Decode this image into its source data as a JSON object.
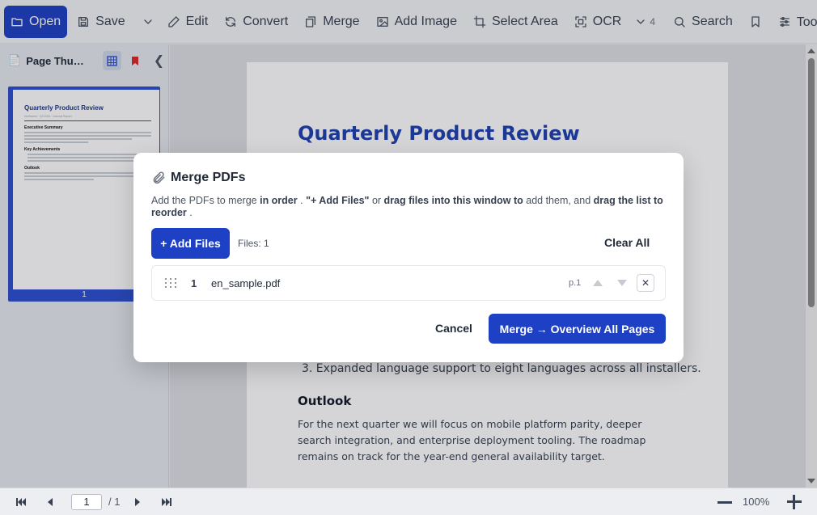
{
  "toolbar": {
    "open": "Open",
    "save": "Save",
    "edit": "Edit",
    "convert": "Convert",
    "merge": "Merge",
    "add_image": "Add Image",
    "select_area": "Select Area",
    "ocr": "OCR",
    "more_count": "4",
    "search": "Search",
    "tools": "Tools ▾"
  },
  "sidebar": {
    "title": "Page Thumbnails",
    "thumbnail_page_number": "1",
    "thumb": {
      "title": "Quarterly Product Review",
      "sub": "Northwind · Q3 2024 · Internal Report",
      "h1": "Executive Summary",
      "h2": "Key Achievements",
      "h3": "Outlook"
    }
  },
  "document": {
    "title": "Quarterly Product Review",
    "list_item_3": "3. Expanded language support to eight languages across all installers.",
    "heading_outlook": "Outlook",
    "outlook_text": "For the next quarter we will focus on mobile platform parity, deeper search integration, and enterprise deployment tooling. The roadmap remains on track for the year-end general availability target."
  },
  "bottombar": {
    "page_input": "1",
    "page_total": "/ 1",
    "zoom": "100%"
  },
  "modal": {
    "title": "Merge PDFs",
    "desc_1": "Add the PDFs to merge ",
    "desc_2": "in order",
    "desc_3": " . ",
    "desc_4": "\"+ Add Files\"",
    "desc_5": " or ",
    "desc_6": "drag files into this window to",
    "desc_7": " add them, and ",
    "desc_8": "drag the list to reorder",
    "desc_9": " .",
    "add_files": "+ Add Files",
    "files_count": "Files: 1",
    "clear_all": "Clear All",
    "files": [
      {
        "index": "1",
        "name": "en_sample.pdf",
        "pages": "p.1"
      }
    ],
    "cancel": "Cancel",
    "merge_button": "Merge → Overview All Pages"
  },
  "colors": {
    "accent": "#1d40c4",
    "doc_title": "#1e40af"
  }
}
